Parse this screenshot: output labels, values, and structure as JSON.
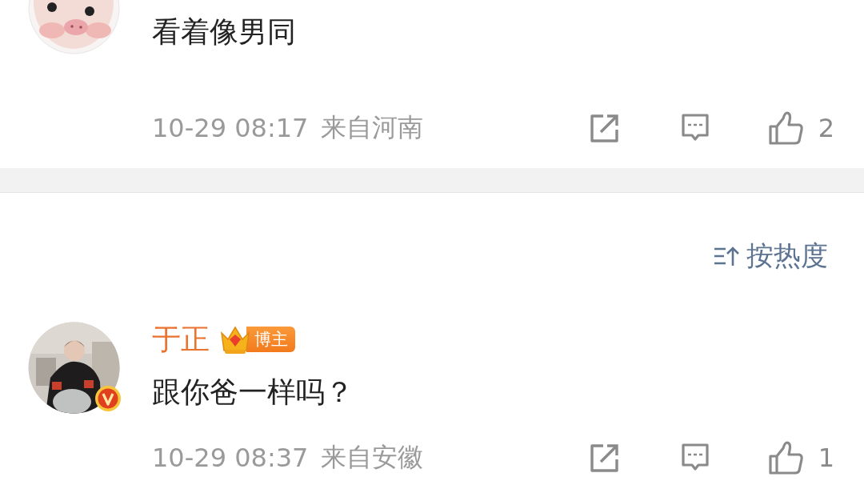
{
  "comments": [
    {
      "avatar": {
        "kind": "pig"
      },
      "verified": false,
      "text": "看着像男同",
      "time": "10-29 08:17",
      "location": "来自河南",
      "likes": "2"
    },
    {
      "verified": true,
      "author": "于正",
      "badge": "博主",
      "text": "跟你爸一样吗？",
      "time": "10-29 08:37",
      "location": "来自安徽",
      "likes": "1"
    }
  ],
  "sort": {
    "label": "按热度"
  }
}
